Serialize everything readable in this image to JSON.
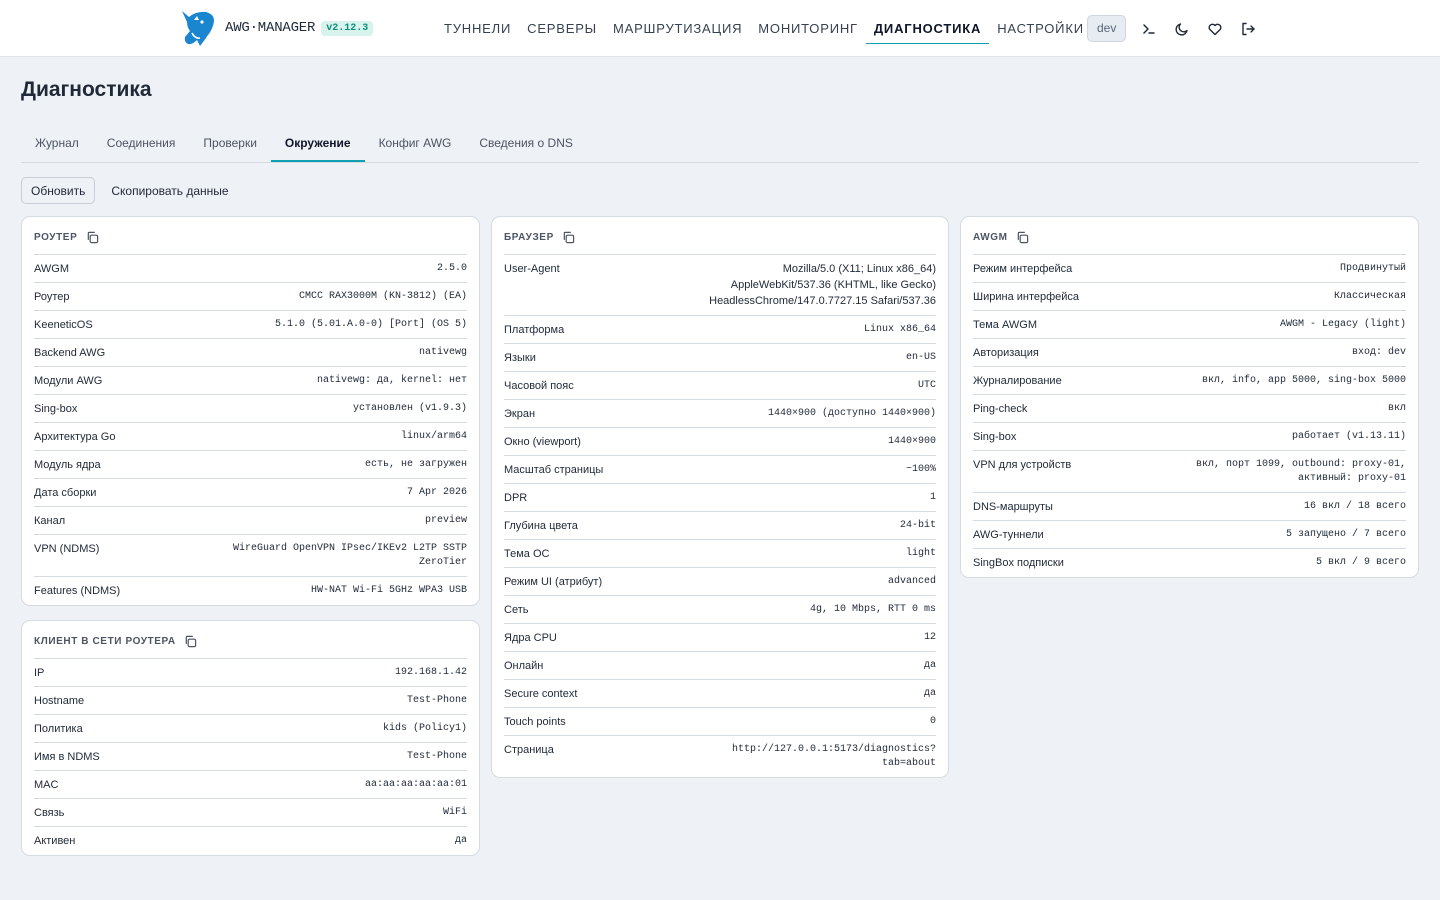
{
  "app": {
    "brand": "AWG·MANAGER",
    "version": "v2.12.3"
  },
  "nav": [
    {
      "label": "ТУННЕЛИ",
      "name": "nav-tunnels",
      "active": false
    },
    {
      "label": "СЕРВЕРЫ",
      "name": "nav-servers",
      "active": false
    },
    {
      "label": "МАРШРУТИЗАЦИЯ",
      "name": "nav-routing",
      "active": false
    },
    {
      "label": "МОНИТОРИНГ",
      "name": "nav-monitoring",
      "active": false
    },
    {
      "label": "ДИАГНОСТИКА",
      "name": "nav-diagnostics",
      "active": true
    },
    {
      "label": "НАСТРОЙКИ",
      "name": "nav-settings",
      "active": false
    }
  ],
  "header_actions": {
    "env_badge": "dev",
    "icons": [
      "terminal-icon",
      "moon-icon",
      "heart-icon",
      "logout-icon"
    ]
  },
  "page": {
    "title": "Диагностика"
  },
  "tabs": [
    {
      "label": "Журнал",
      "name": "tab-journal",
      "active": false
    },
    {
      "label": "Соединения",
      "name": "tab-connections",
      "active": false
    },
    {
      "label": "Проверки",
      "name": "tab-checks",
      "active": false
    },
    {
      "label": "Окружение",
      "name": "tab-environment",
      "active": true
    },
    {
      "label": "Конфиг AWG",
      "name": "tab-awg-config",
      "active": false
    },
    {
      "label": "Сведения о DNS",
      "name": "tab-dns-info",
      "active": false
    }
  ],
  "toolbar": {
    "refresh_label": "Обновить",
    "copy_label": "Скопировать данные"
  },
  "cards": {
    "router": {
      "title": "РОУТЕР",
      "rows": [
        {
          "k": "AWGM",
          "v": "2.5.0"
        },
        {
          "k": "Роутер",
          "v": "CMCC RAX3000M (KN-3812) (EA)"
        },
        {
          "k": "KeeneticOS",
          "v": "5.1.0 (5.01.A.0-0) [Port] (OS 5)"
        },
        {
          "k": "Backend AWG",
          "v": "nativewg"
        },
        {
          "k": "Модули AWG",
          "v": "nativewg: да, kernel: нет"
        },
        {
          "k": "Sing-box",
          "v": "установлен (v1.9.3)"
        },
        {
          "k": "Архитектура Go",
          "v": "linux/arm64"
        },
        {
          "k": "Модуль ядра",
          "v": "есть, не загружен"
        },
        {
          "k": "Дата сборки",
          "v": "7 Apr 2026"
        },
        {
          "k": "Канал",
          "v": "preview"
        },
        {
          "k": "VPN (NDMS)",
          "v": "WireGuard OpenVPN IPsec/IKEv2 L2TP SSTP\nZeroTier"
        },
        {
          "k": "Features (NDMS)",
          "v": "HW-NAT Wi-Fi 5GHz WPA3 USB"
        }
      ]
    },
    "client": {
      "title": "КЛИЕНТ В СЕТИ РОУТЕРА",
      "rows": [
        {
          "k": "IP",
          "v": "192.168.1.42"
        },
        {
          "k": "Hostname",
          "v": "Test-Phone"
        },
        {
          "k": "Политика",
          "v": "kids (Policy1)"
        },
        {
          "k": "Имя в NDMS",
          "v": "Test-Phone"
        },
        {
          "k": "MAC",
          "v": "aa:aa:aa:aa:aa:01"
        },
        {
          "k": "Связь",
          "v": "WiFi"
        },
        {
          "k": "Активен",
          "v": "да"
        }
      ]
    },
    "browser": {
      "title": "БРАУЗЕР",
      "rows": [
        {
          "k": "User-Agent",
          "v": "Mozilla/5.0 (X11; Linux x86_64)\nAppleWebKit/537.36 (KHTML, like Gecko)\nHeadlessChrome/147.0.7727.15 Safari/537.36",
          "sans": true
        },
        {
          "k": "Платформа",
          "v": "Linux x86_64"
        },
        {
          "k": "Языки",
          "v": "en-US"
        },
        {
          "k": "Часовой пояс",
          "v": "UTC"
        },
        {
          "k": "Экран",
          "v": "1440×900 (доступно 1440×900)"
        },
        {
          "k": "Окно (viewport)",
          "v": "1440×900"
        },
        {
          "k": "Масштаб страницы",
          "v": "~100%"
        },
        {
          "k": "DPR",
          "v": "1"
        },
        {
          "k": "Глубина цвета",
          "v": "24-bit"
        },
        {
          "k": "Тема ОС",
          "v": "light"
        },
        {
          "k": "Режим UI (атрибут)",
          "v": "advanced"
        },
        {
          "k": "Сеть",
          "v": "4g, 10 Mbps, RTT 0 ms"
        },
        {
          "k": "Ядра CPU",
          "v": "12"
        },
        {
          "k": "Онлайн",
          "v": "да"
        },
        {
          "k": "Secure context",
          "v": "да"
        },
        {
          "k": "Touch points",
          "v": "0"
        },
        {
          "k": "Страница",
          "v": "http://127.0.0.1:5173/diagnostics?\ntab=about"
        }
      ]
    },
    "awgm": {
      "title": "AWGM",
      "rows": [
        {
          "k": "Режим интерфейса",
          "v": "Продвинутый"
        },
        {
          "k": "Ширина интерфейса",
          "v": "Классическая"
        },
        {
          "k": "Тема AWGM",
          "v": "AWGM - Legacy (light)"
        },
        {
          "k": "Авторизация",
          "v": "вход: dev"
        },
        {
          "k": "Журналирование",
          "v": "вкл, info, app 5000, sing-box 5000"
        },
        {
          "k": "Ping-check",
          "v": "вкл"
        },
        {
          "k": "Sing-box",
          "v": "работает (v1.13.11)"
        },
        {
          "k": "VPN для устройств",
          "v": "вкл, порт 1099, outbound: proxy-01,\nактивный: proxy-01"
        },
        {
          "k": "DNS-маршруты",
          "v": "16 вкл / 18 всего"
        },
        {
          "k": "AWG-туннели",
          "v": "5 запущено / 7 всего"
        },
        {
          "k": "SingBox подписки",
          "v": "5 вкл / 9 всего"
        }
      ]
    }
  }
}
